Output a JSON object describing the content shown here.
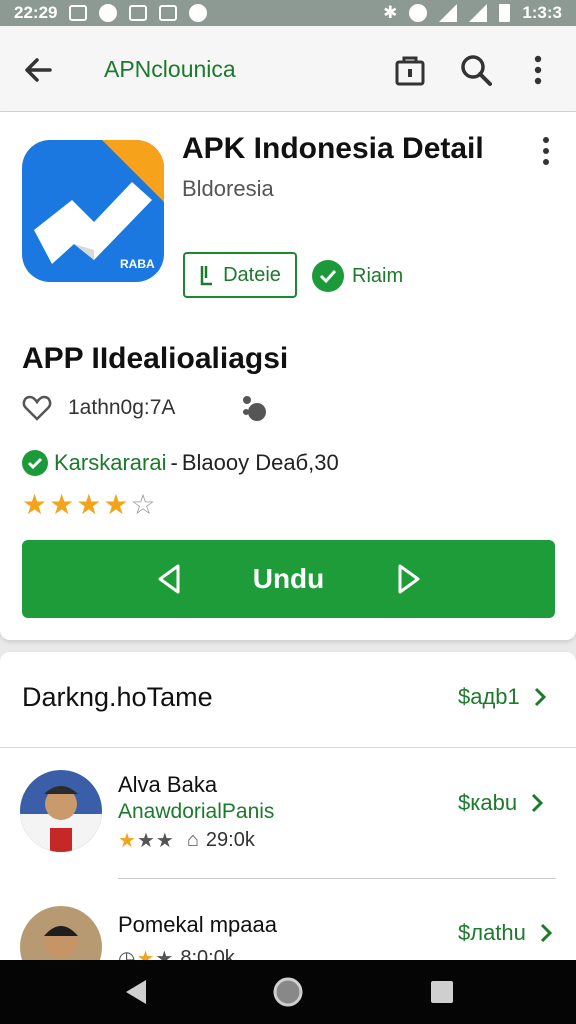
{
  "status_bar": {
    "time": "22:29",
    "clock_right": "1:3:3"
  },
  "app_bar": {
    "title": "APNclounica"
  },
  "app": {
    "title": "APK Indonesia Detail",
    "developer": "Bldoresia",
    "detail_button_label": "Dateie",
    "rate_button_label": "Riaim",
    "icon_badge_text": "RABA"
  },
  "section": {
    "title": "APP IIdealioaliagsi",
    "meta_text": "1athn0g:7А",
    "verified_label": "Karskarаrаi",
    "verified_separator": "-",
    "verified_detail": "Blaooy Deаб,30",
    "star_rating": 4,
    "star_max": 5,
    "download_label": "Undu"
  },
  "list": {
    "title": "Darkng.hoTame",
    "see_all_label": "$адb1",
    "items": [
      {
        "name": "Alva Baka",
        "subtitle": "AnawdorialPanis",
        "rating": 3,
        "stat": "29:0k",
        "price": "$каbu"
      },
      {
        "name": "Pomekal mpaaa",
        "subtitle": "",
        "rating": 2,
        "stat": "8:0:0k",
        "price": "$лаthu"
      }
    ]
  },
  "colors": {
    "accent_green": "#1e9c3a",
    "text_green": "#1c7a2c",
    "star": "#f2a51b"
  }
}
